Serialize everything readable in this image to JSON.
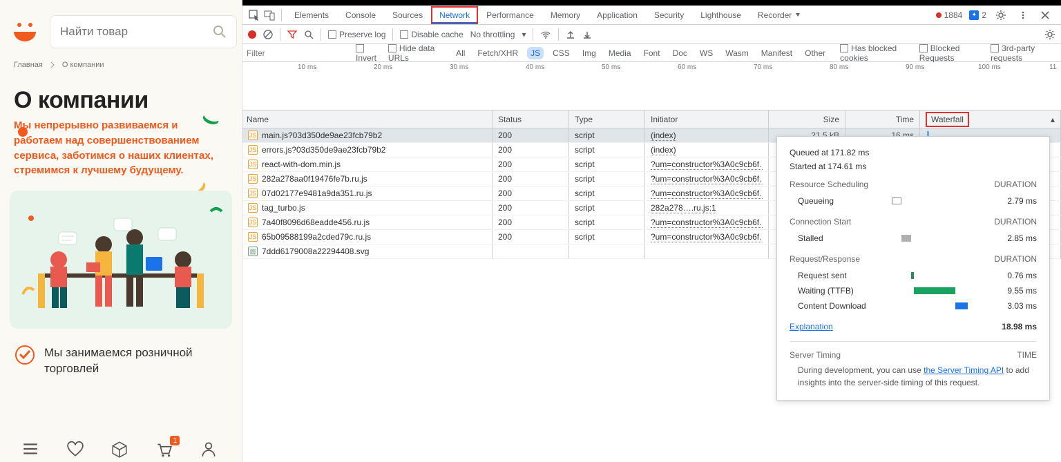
{
  "site": {
    "search_placeholder": "Найти товар",
    "breadcrumb": [
      "Главная",
      "О компании"
    ],
    "title": "О компании",
    "subtitle": "Мы непрерывно развиваемся и работаем над совершенствованием сервиса, заботимся о наших клиентах, стремимся к лучшему будущему.",
    "feature1": "Мы занимаемся розничной торговлей",
    "cart_badge": "1"
  },
  "devtools": {
    "tabs": [
      "Elements",
      "Console",
      "Sources",
      "Network",
      "Performance",
      "Memory",
      "Application",
      "Security",
      "Lighthouse",
      "Recorder"
    ],
    "active_tab": "Network",
    "errors_count": "1884",
    "messages_count": "2",
    "toolbar": {
      "preserve": "Preserve log",
      "disable": "Disable cache",
      "throttle": "No throttling"
    },
    "filter_placeholder": "Filter",
    "filter_opts": {
      "invert": "Invert",
      "hide": "Hide data URLs"
    },
    "ftabs": [
      "All",
      "Fetch/XHR",
      "JS",
      "CSS",
      "Img",
      "Media",
      "Font",
      "Doc",
      "WS",
      "Wasm",
      "Manifest",
      "Other"
    ],
    "ftab_active": "JS",
    "fchecks": [
      "Has blocked cookies",
      "Blocked Requests",
      "3rd-party requests"
    ],
    "timeline_ticks": [
      "10 ms",
      "20 ms",
      "30 ms",
      "40 ms",
      "50 ms",
      "60 ms",
      "70 ms",
      "80 ms",
      "90 ms",
      "100 ms",
      "11"
    ],
    "cols": {
      "name": "Name",
      "status": "Status",
      "type": "Type",
      "init": "Initiator",
      "size": "Size",
      "time": "Time",
      "wf": "Waterfall"
    },
    "rows": [
      {
        "name": "main.js?03d350de9ae23fcb79b2",
        "status": "200",
        "type": "script",
        "init": "(index)",
        "size": "21.5 kB",
        "time": "16 ms",
        "sel": true
      },
      {
        "name": "errors.js?03d350de9ae23fcb79b2",
        "status": "200",
        "type": "script",
        "init": "(index)",
        "size": "",
        "time": ""
      },
      {
        "name": "react-with-dom.min.js",
        "status": "200",
        "type": "script",
        "init": "?um=constructor%3A0c9cb6f…",
        "size": "",
        "time": ""
      },
      {
        "name": "282a278aa0f19476fe7b.ru.js",
        "status": "200",
        "type": "script",
        "init": "?um=constructor%3A0c9cb6f…",
        "size": "",
        "time": ""
      },
      {
        "name": "07d02177e9481a9da351.ru.js",
        "status": "200",
        "type": "script",
        "init": "?um=constructor%3A0c9cb6f…",
        "size": "",
        "time": ""
      },
      {
        "name": "tag_turbo.js",
        "status": "200",
        "type": "script",
        "init": "282a278….ru.js:1",
        "size": "",
        "time": ""
      },
      {
        "name": "7a40f8096d68eadde456.ru.js",
        "status": "200",
        "type": "script",
        "init": "?um=constructor%3A0c9cb6f…",
        "size": "",
        "time": ""
      },
      {
        "name": "65b09588199a2cded79c.ru.js",
        "status": "200",
        "type": "script",
        "init": "?um=constructor%3A0c9cb6f…",
        "size": "",
        "time": ""
      },
      {
        "name": "7ddd6179008a22294408.svg",
        "status": "",
        "type": "",
        "init": "",
        "size": "",
        "time": "",
        "img": true
      }
    ],
    "timing": {
      "queued": "Queued at 171.82 ms",
      "started": "Started at 174.61 ms",
      "sects": {
        "sched": {
          "title": "Resource Scheduling",
          "dur": "DURATION",
          "rows": [
            {
              "lab": "Queueing",
              "val": "2.79 ms",
              "color": "#fff",
              "border": "#888",
              "w": 14
            }
          ]
        },
        "conn": {
          "title": "Connection Start",
          "dur": "DURATION",
          "rows": [
            {
              "lab": "Stalled",
              "val": "2.85 ms",
              "color": "#b0b0b0",
              "w": 14
            }
          ]
        },
        "req": {
          "title": "Request/Response",
          "dur": "DURATION",
          "rows": [
            {
              "lab": "Request sent",
              "val": "0.76 ms",
              "color": "#2e8b57",
              "w": 4,
              "off": 58
            },
            {
              "lab": "Waiting (TTFB)",
              "val": "9.55 ms",
              "color": "#1aa260",
              "w": 60,
              "off": 60
            },
            {
              "lab": "Content Download",
              "val": "3.03 ms",
              "color": "#1a73e8",
              "w": 18,
              "off": 102
            }
          ]
        }
      },
      "explanation": "Explanation",
      "total": "18.98 ms",
      "server_timing": "Server Timing",
      "server_col": "TIME",
      "server_note1": "During development, you can use ",
      "server_link": "the Server Timing API",
      "server_note2": " to add insights into the server-side timing of this request."
    }
  }
}
